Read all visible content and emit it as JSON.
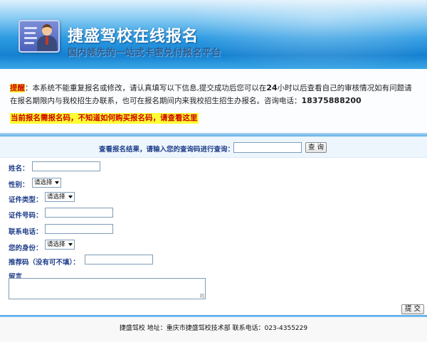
{
  "header": {
    "title": "捷盛驾校在线报名",
    "subtitle": "国内领先的一站式卡密兑付报名平台"
  },
  "notice": {
    "tag": "提醒",
    "text_part1": "：本系统不能重复报名或修改，请认真填写以下信息,提交成功后您可以在",
    "hours": "24",
    "text_part2": "小时以后查看自己的审核情况如有问题请在报名期限内与我校招生办联系，也可在报名期间内来我校招生招生办报名。咨询电话：",
    "phone": "18375888200",
    "link_text": "当前报名需报名码，不知道如何购买报名码，请查看这里"
  },
  "query": {
    "label": "查看报名结果，请输入您的查询码进行查询：",
    "input_value": "",
    "button_label": "查 询"
  },
  "form": {
    "name_label": "姓名：",
    "name_value": "",
    "gender_label": "性别：",
    "gender_value": "请选择",
    "id_type_label": "证件类型：",
    "id_type_value": "请选择",
    "id_number_label": "证件号码：",
    "id_number_value": "",
    "phone_label": "联系电话：",
    "phone_value": "",
    "identity_label": "您的身份：",
    "identity_value": "请选择",
    "referral_label": "推荐码（没有可不填）：",
    "referral_value": "",
    "message_label": "留言",
    "message_value": "",
    "submit_label": "提 交"
  },
  "footer": {
    "text": "捷盛驾校 地址：重庆市捷盛驾校技术部 联系电话：023-4355229"
  }
}
